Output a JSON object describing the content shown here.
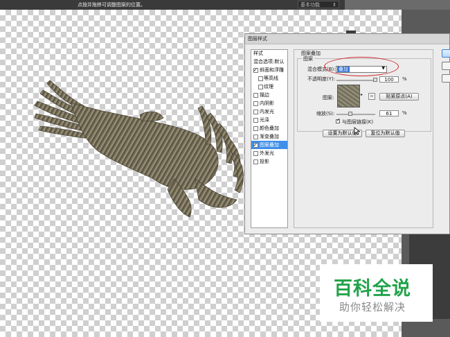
{
  "topbar": {
    "hint": "点按并拖移可调整图案的位置。",
    "workspace": "基本功能",
    "workspace_arrow": "⇕"
  },
  "dialog": {
    "title": "图层样式",
    "styles_header": "样式",
    "blend_options": "混合选项:默认",
    "items": [
      {
        "label": "斜面和浮雕",
        "checked": true,
        "indent": false,
        "selected": false
      },
      {
        "label": "等高线",
        "checked": false,
        "indent": true,
        "selected": false
      },
      {
        "label": "纹理",
        "checked": false,
        "indent": true,
        "selected": false
      },
      {
        "label": "描边",
        "checked": false,
        "indent": false,
        "selected": false
      },
      {
        "label": "内阴影",
        "checked": false,
        "indent": false,
        "selected": false
      },
      {
        "label": "内发光",
        "checked": false,
        "indent": false,
        "selected": false
      },
      {
        "label": "光泽",
        "checked": false,
        "indent": false,
        "selected": false
      },
      {
        "label": "颜色叠加",
        "checked": false,
        "indent": false,
        "selected": false
      },
      {
        "label": "渐变叠加",
        "checked": false,
        "indent": false,
        "selected": false
      },
      {
        "label": "图案叠加",
        "checked": true,
        "indent": false,
        "selected": true
      },
      {
        "label": "外发光",
        "checked": false,
        "indent": false,
        "selected": false
      },
      {
        "label": "投影",
        "checked": false,
        "indent": false,
        "selected": false
      }
    ],
    "section_title": "图案叠加",
    "subsection_title": "图案",
    "blend_mode_label": "混合模式(B):",
    "blend_mode_value": "叠加",
    "opacity_label": "不透明度(Y):",
    "opacity_value": "100",
    "opacity_fraction": 1.0,
    "percent": "%",
    "pattern_label": "图案:",
    "snap_origin_button": "贴紧原点(A)",
    "scale_label": "缩放(S):",
    "scale_value": "61",
    "scale_fraction": 0.61,
    "link_layer_label": "与图层链接(K)",
    "link_layer_checked": true,
    "set_default_button": "设置为默认值",
    "reset_default_button": "复位为默认值"
  },
  "watermark": {
    "title": "百科全说",
    "subtitle": "助你轻松解决",
    "title_color": "#22a34a"
  },
  "colors": {
    "selection": "#3f8ee8",
    "highlight_ellipse": "#d0262c"
  }
}
